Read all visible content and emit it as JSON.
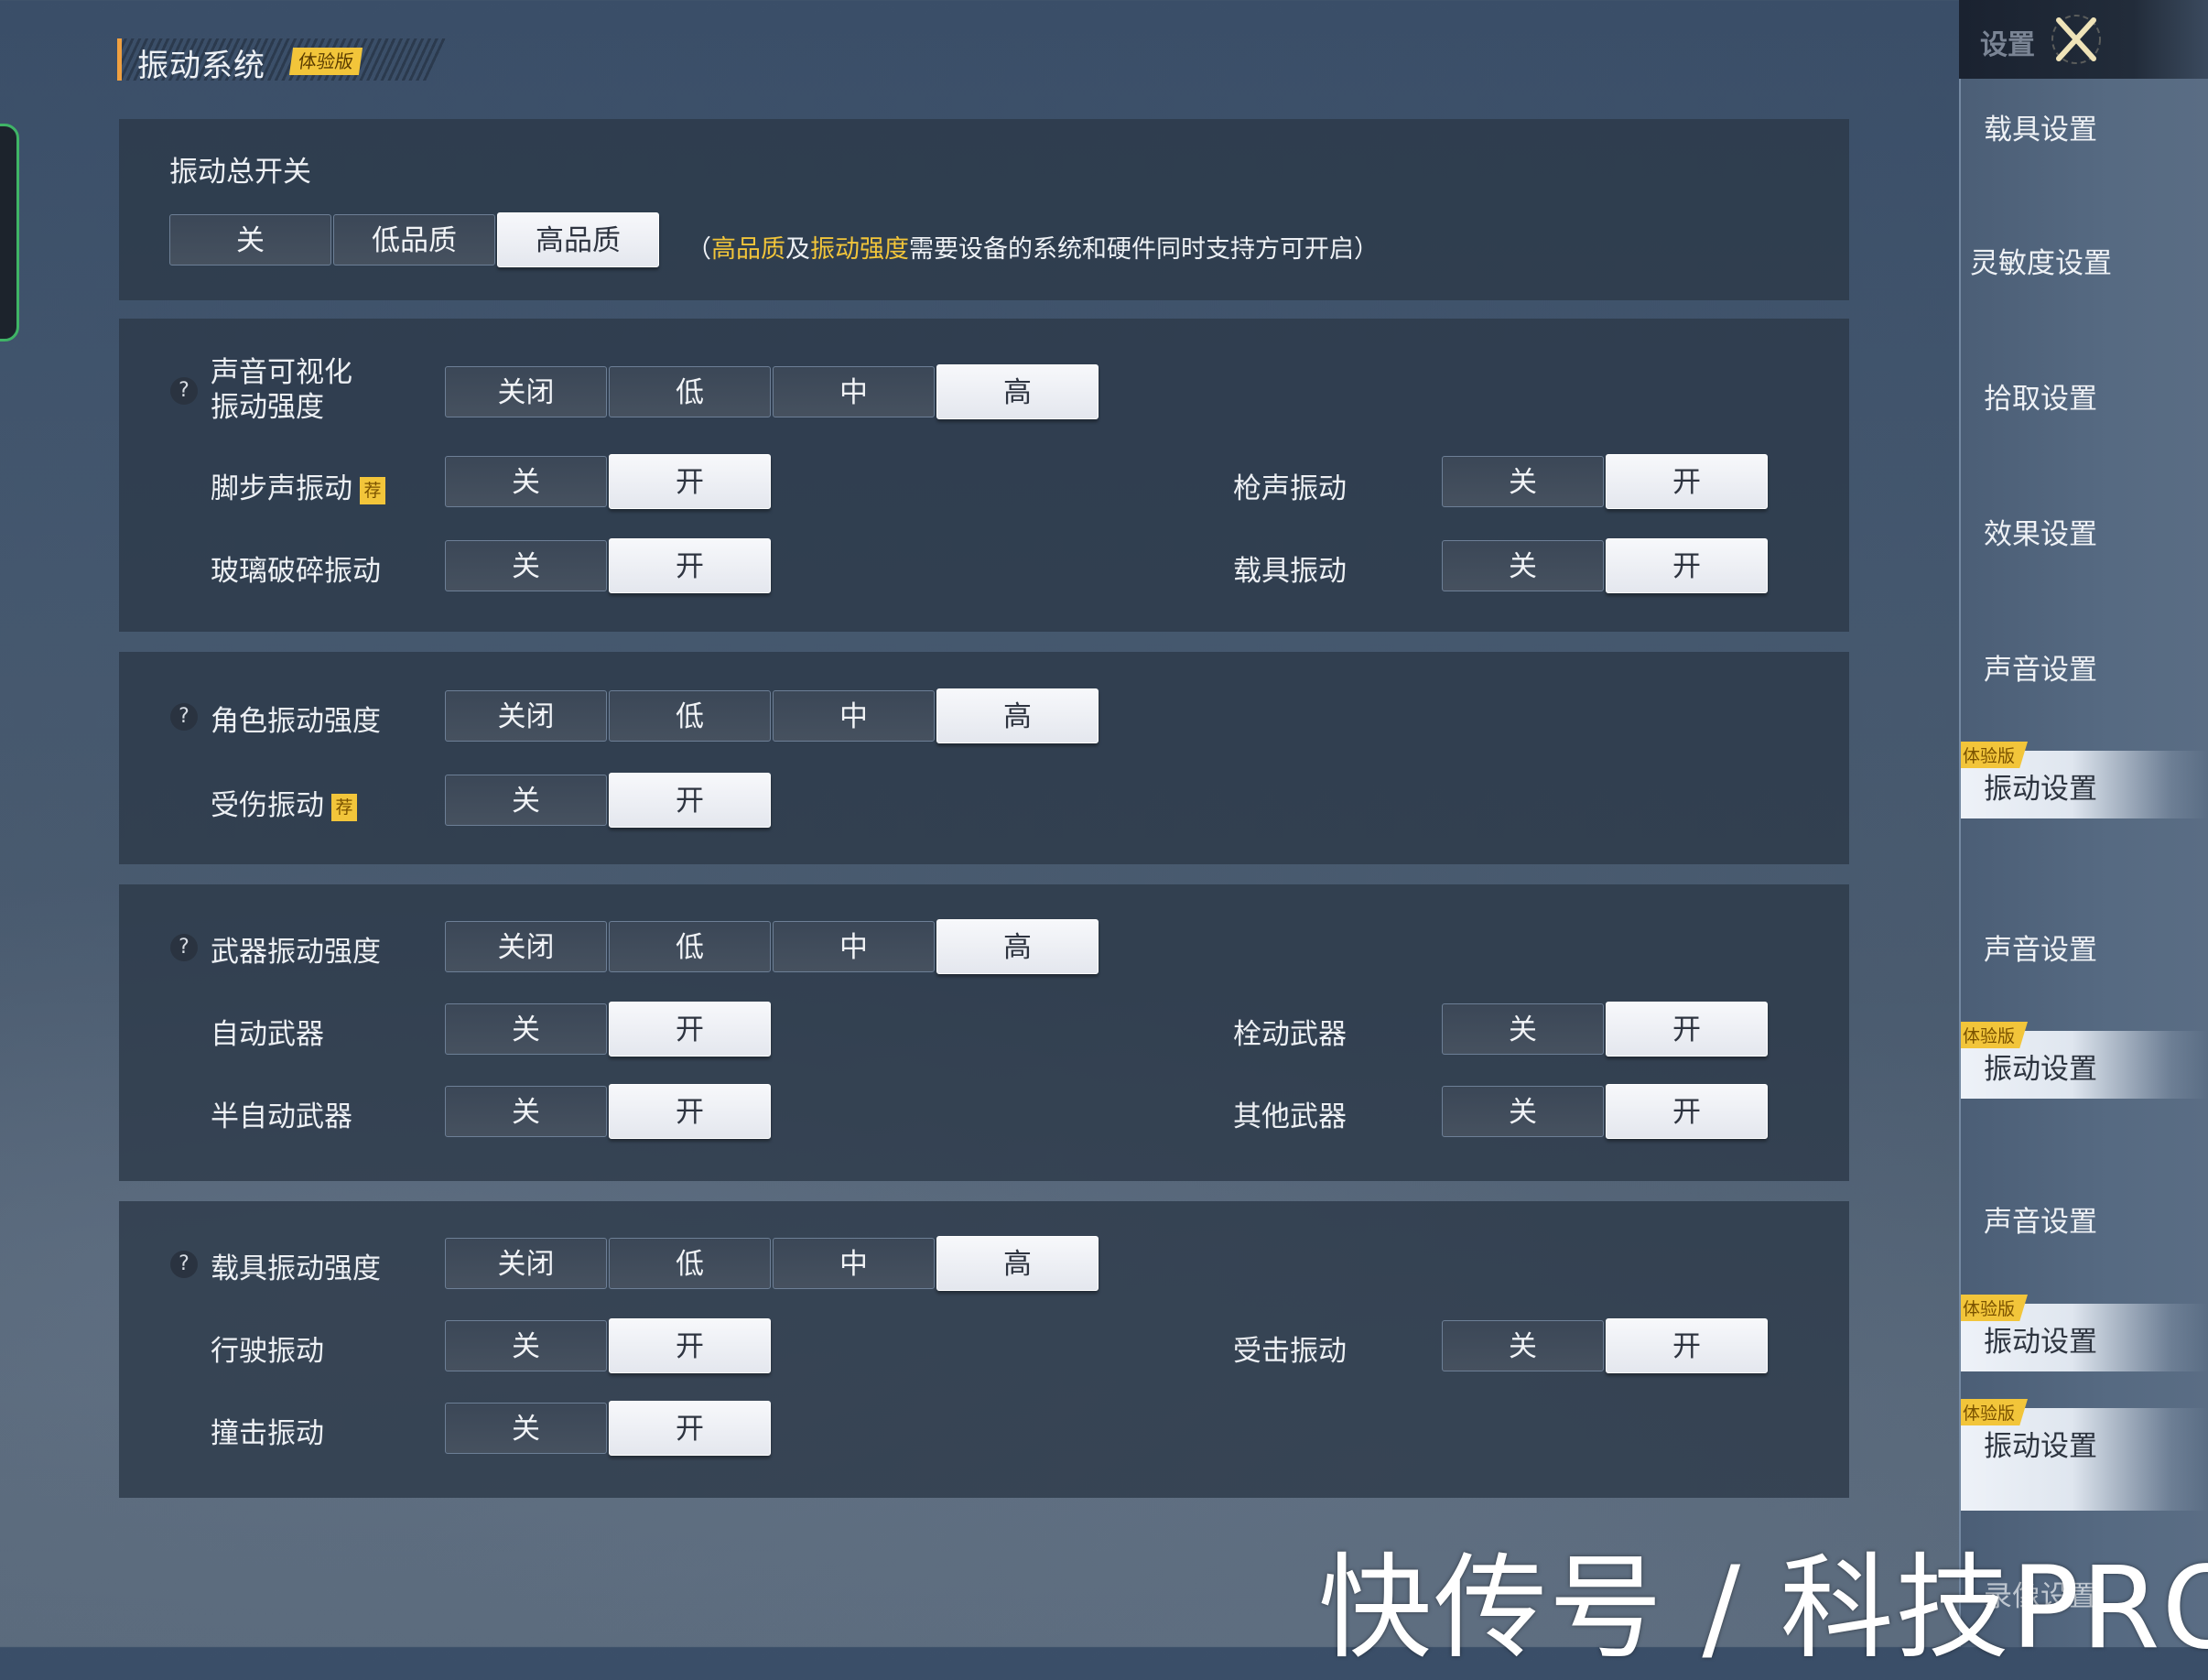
{
  "header": {
    "title": "振动系统",
    "badge": "体验版"
  },
  "master": {
    "label": "振动总开关",
    "options": [
      "关",
      "低品质",
      "高品质"
    ],
    "selected": "高品质",
    "note_open": "（",
    "note_hl1": "高品质",
    "note_mid": "及",
    "note_hl2": "振动强度",
    "note_rest": "需要设备的系统和硬件同时支持方可开启）"
  },
  "intensity_options": [
    "关闭",
    "低",
    "中",
    "高"
  ],
  "toggle_options": [
    "关",
    "开"
  ],
  "recommend_badge": "荐",
  "help_icon": "?",
  "sections": [
    {
      "intensity_label_line1": "声音可视化",
      "intensity_label_line2": "振动强度",
      "intensity_selected": "高",
      "toggles": [
        {
          "label": "脚步声振动",
          "recommended": true,
          "value": "开"
        },
        {
          "label": "枪声振动",
          "recommended": false,
          "value": "开"
        },
        {
          "label": "玻璃破碎振动",
          "recommended": false,
          "value": "开"
        },
        {
          "label": "载具振动",
          "recommended": false,
          "value": "开"
        }
      ]
    },
    {
      "intensity_label": "角色振动强度",
      "intensity_selected": "高",
      "toggles": [
        {
          "label": "受伤振动",
          "recommended": true,
          "value": "开"
        }
      ]
    },
    {
      "intensity_label": "武器振动强度",
      "intensity_selected": "高",
      "toggles": [
        {
          "label": "自动武器",
          "recommended": false,
          "value": "开"
        },
        {
          "label": "栓动武器",
          "recommended": false,
          "value": "开"
        },
        {
          "label": "半自动武器",
          "recommended": false,
          "value": "开"
        },
        {
          "label": "其他武器",
          "recommended": false,
          "value": "开"
        }
      ]
    },
    {
      "intensity_label": "载具振动强度",
      "intensity_selected": "高",
      "toggles": [
        {
          "label": "行驶振动",
          "recommended": false,
          "value": "开"
        },
        {
          "label": "受击振动",
          "recommended": false,
          "value": "开"
        },
        {
          "label": "撞击振动",
          "recommended": false,
          "value": "开"
        }
      ]
    }
  ],
  "sidebar": {
    "header_label": "设置",
    "items": [
      {
        "label": "载具设置",
        "active": false
      },
      {
        "label": "灵敏度设置",
        "active": false
      },
      {
        "label": "拾取设置",
        "active": false
      },
      {
        "label": "效果设置",
        "active": false
      },
      {
        "label": "声音设置",
        "active": false
      },
      {
        "label": "振动设置",
        "active": true,
        "badge": "体验版"
      },
      {
        "label": "声音设置",
        "active": false
      },
      {
        "label": "振动设置",
        "active": true,
        "badge": "体验版"
      },
      {
        "label": "声音设置",
        "active": false
      },
      {
        "label": "振动设置",
        "active": true,
        "badge": "体验版"
      },
      {
        "label": "振动设置",
        "active": true,
        "badge": "体验版"
      },
      {
        "label": "录像设置",
        "active": false
      }
    ]
  },
  "watermark": "快传号 / 科技PRO",
  "colors": {
    "accent_yellow": "#f2c53a",
    "title_bar_orange": "#f0a040",
    "left_tab_green": "#3fb466",
    "selected_bg": "#f2f4f8"
  }
}
